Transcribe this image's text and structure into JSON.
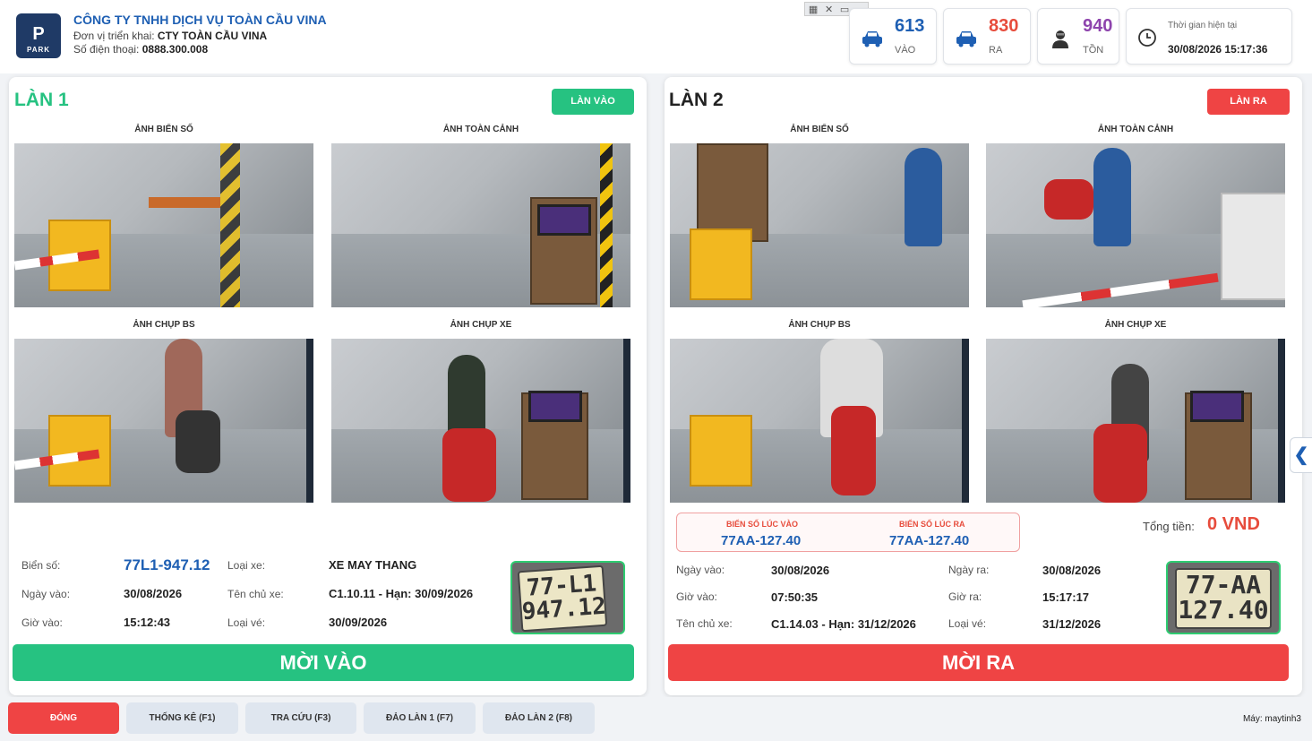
{
  "header": {
    "logo_letter": "P",
    "logo_text": "PARK",
    "company_name": "CÔNG TY TNHH DỊCH VỤ TOÀN CẦU VINA",
    "unit_label": "Đơn vị triển khai:",
    "unit_value": "CTY TOÀN CẦU VINA",
    "phone_label": "Số điện thoại:",
    "phone_value": "0888.300.008"
  },
  "stats": {
    "vao": {
      "count": "613",
      "label": "VÀO",
      "color": "#1e5fb3"
    },
    "ra": {
      "count": "830",
      "label": "RA",
      "color": "#e74c3c"
    },
    "ton": {
      "count": "940",
      "label": "TỒN",
      "color": "#8e44ad"
    },
    "clock": {
      "label": "Thời gian hiện tại",
      "time": "30/08/2026 15:17:36"
    }
  },
  "lane1": {
    "title": "LÀN 1",
    "mode": "LÀN VÀO",
    "cams": [
      "ẢNH BIỂN SỐ",
      "ẢNH TOÀN CẢNH",
      "ẢNH CHỤP BS",
      "ẢNH CHỤP XE"
    ],
    "plate_label": "Biển số:",
    "plate_value": "77L1-947.12",
    "date_in_label": "Ngày vào:",
    "date_in_value": "30/08/2026",
    "time_in_label": "Giờ vào:",
    "time_in_value": "15:12:43",
    "vehicle_type_label": "Loại xe:",
    "vehicle_type_value": "XE MAY THANG",
    "owner_label": "Tên chủ xe:",
    "owner_value": "C1.10.11 - Hạn: 30/09/2026",
    "ticket_label": "Loại vé:",
    "ticket_value": "30/09/2026",
    "plate_img_line1": "77-L1",
    "plate_img_line2": "947.12",
    "action": "MỜI VÀO"
  },
  "lane2": {
    "title": "LÀN 2",
    "mode": "LÀN RA",
    "cams": [
      "ẢNH BIỂN SỐ",
      "ẢNH TOÀN CẢNH",
      "ẢNH CHỤP BS",
      "ẢNH CHỤP XE"
    ],
    "plate_in_label": "BIỂN SỐ LÚC VÀO",
    "plate_in_value": "77AA-127.40",
    "plate_out_label": "BIỂN SỐ LÚC RA",
    "plate_out_value": "77AA-127.40",
    "total_label": "Tổng tiền:",
    "total_value": "0 VND",
    "date_in_label": "Ngày vào:",
    "date_in_value": "30/08/2026",
    "time_in_label": "Giờ vào:",
    "time_in_value": "07:50:35",
    "owner_label": "Tên chủ xe:",
    "owner_value": "C1.14.03 - Hạn: 31/12/2026",
    "date_out_label": "Ngày ra:",
    "date_out_value": "30/08/2026",
    "time_out_label": "Giờ ra:",
    "time_out_value": "15:17:17",
    "ticket_label": "Loại vé:",
    "ticket_value": "31/12/2026",
    "plate_img_line1": "77-AA",
    "plate_img_line2": "127.40",
    "action": "MỜI RA"
  },
  "footer": {
    "close": "ĐÓNG",
    "stats": "THỐNG KÊ (F1)",
    "search": "TRA CỨU (F3)",
    "swap1": "ĐẢO LÀN 1 (F7)",
    "swap2": "ĐẢO LÀN 2 (F8)",
    "machine": "Máy: maytinh3"
  },
  "side_tab_glyph": "❮",
  "colors": {
    "green": "#26c281",
    "red": "#ef4444",
    "blue": "#1e5fb3"
  }
}
